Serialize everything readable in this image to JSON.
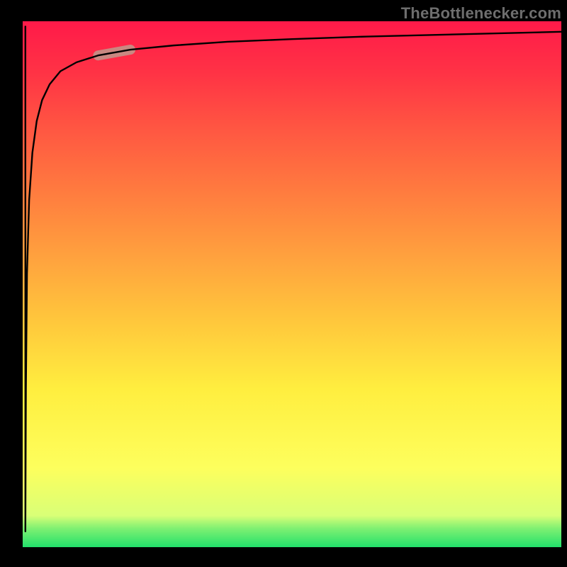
{
  "watermark": {
    "text": "TheBottlenecker.com"
  },
  "chart_data": {
    "type": "line",
    "title": "",
    "xlabel": "",
    "ylabel": "",
    "xlim": [
      0,
      100
    ],
    "ylim": [
      0,
      100
    ],
    "grid": false,
    "background_gradient": {
      "direction": "vertical",
      "stops": [
        {
          "pos": 0.0,
          "color": "#22e06b"
        },
        {
          "pos": 0.06,
          "color": "#d9ff77"
        },
        {
          "pos": 0.15,
          "color": "#fdff5d"
        },
        {
          "pos": 0.43,
          "color": "#ffc73c"
        },
        {
          "pos": 0.68,
          "color": "#ff7a3f"
        },
        {
          "pos": 1.0,
          "color": "#ff1a49"
        }
      ]
    },
    "series": [
      {
        "name": "bottleneck-curve",
        "color": "#000000",
        "x": [
          0.5,
          0.5,
          0.6,
          0.8,
          1.2,
          1.8,
          2.6,
          3.6,
          5.0,
          7.0,
          10.0,
          14.0,
          20.0,
          28.0,
          38.0,
          50.0,
          64.0,
          80.0,
          100.0
        ],
        "y": [
          99.0,
          3.0,
          30.0,
          52.0,
          66.0,
          75.0,
          81.0,
          85.0,
          88.0,
          90.5,
          92.2,
          93.5,
          94.6,
          95.4,
          96.1,
          96.6,
          97.1,
          97.5,
          98.0
        ]
      }
    ],
    "highlight_segment": {
      "series": "bottleneck-curve",
      "approx_x_range": [
        12,
        20
      ],
      "approx_y_range": [
        85,
        90
      ],
      "color": "#c98881",
      "stroke_width_px": 14
    }
  }
}
